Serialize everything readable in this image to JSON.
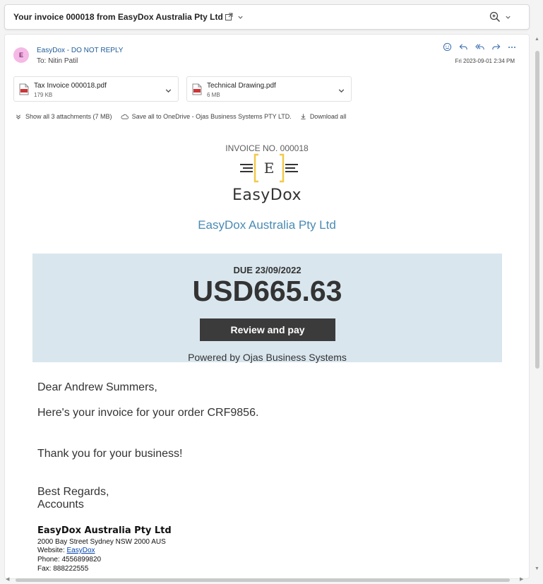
{
  "header": {
    "subject": "Your invoice 000018 from EasyDox Australia Pty Ltd",
    "icons": [
      "pop-out-icon",
      "chevron-down-icon",
      "zoom-icon",
      "chevron-down-icon"
    ]
  },
  "message": {
    "avatar_initial": "E",
    "sender": "EasyDox - DO NOT REPLY",
    "to": "To: Nitin Patil",
    "date": "Fri 2023-09-01 2:34 PM",
    "action_icons": [
      "emoji-icon",
      "reply-icon",
      "reply-all-icon",
      "forward-icon",
      "more-icon"
    ]
  },
  "attachments": [
    {
      "name": "Tax Invoice 000018.pdf",
      "size": "179 KB"
    },
    {
      "name": "Technical Drawing.pdf",
      "size": "6 MB"
    }
  ],
  "attachment_actions": {
    "show_all": "Show all 3 attachments (7 MB)",
    "save_all": "Save all to OneDrive - Ojas Business Systems PTY LTD.",
    "download_all": "Download all"
  },
  "invoice": {
    "invoice_no": "INVOICE NO. 000018",
    "logo_letter": "E",
    "logo_word": "EasyDox",
    "company": "EasyDox Australia Pty Ltd",
    "due": "DUE 23/09/2022",
    "amount": "USD665.63",
    "pay_button": "Review and pay",
    "powered_by": "Powered by Ojas Business Systems"
  },
  "body": {
    "greeting": "Dear Andrew Summers,",
    "line1": "Here's your invoice for your order CRF9856.",
    "thanks": "Thank you for your business!",
    "regards": "Best Regards,",
    "team": "Accounts"
  },
  "signature": {
    "company": "EasyDox Australia Pty Ltd",
    "address": "2000 Bay Street Sydney NSW 2000 AUS",
    "website_label": "Website: ",
    "website_link": "EasyDox",
    "phone": "Phone: 4556899820",
    "fax": "Fax: 888222555"
  },
  "colors": {
    "accent_blue": "#4a8bb3",
    "due_box": "#d9e6ee",
    "button": "#3b3b3b",
    "logo_bracket": "#f2c94c"
  }
}
